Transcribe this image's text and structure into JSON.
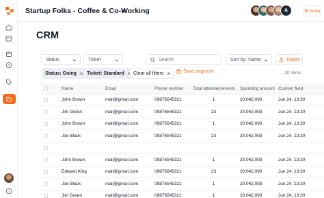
{
  "header": {
    "workspace_title": "Startup Folks - Coffee & Co-Working",
    "avatar_initial": "A",
    "invite_label": "Invite"
  },
  "page": {
    "title": "CRM"
  },
  "filters": {
    "status_label": "Status",
    "ticket_label": "Ticket",
    "search_placeholder": "Search",
    "sort_label": "Sort by: Name",
    "export_label": "Export"
  },
  "active_filters": {
    "chips": [
      "Status: Going",
      "Ticket: Standard"
    ],
    "clear_label": "Clear all filters",
    "save_label": "Save segment",
    "items_count": "20 items"
  },
  "table": {
    "columns": [
      "Name",
      "Email",
      "Phone number",
      "Total attended events",
      "Spending amount",
      "Custom field"
    ],
    "rows": [
      {
        "name": "John Brown",
        "email": "mail@gmail.com",
        "phone": "09876545321",
        "events": "1",
        "spending": "20,042,093",
        "custom": "Jun 24, 13:30"
      },
      {
        "name": "Jim Green",
        "email": "mail@gmail.com",
        "phone": "09876545321",
        "events": "23",
        "spending": "20,042,093",
        "custom": "Jun 24, 13:30"
      },
      {
        "name": "John Brown",
        "email": "mail@gmail.com",
        "phone": "09876545321",
        "events": "1",
        "spending": "20,042,093",
        "custom": "Jun 24, 13:30"
      },
      {
        "name": "Joe Black",
        "email": "mail@gmail.com",
        "phone": "09876545321",
        "events": "23",
        "spending": "20,042,093",
        "custom": "Jun 24, 13:30"
      },
      {
        "name": "",
        "email": "",
        "phone": "",
        "events": "",
        "spending": "",
        "custom": ""
      },
      {
        "name": "John Brown",
        "email": "mail@gmail.com",
        "phone": "09876545321",
        "events": "1",
        "spending": "20,042,093",
        "custom": "Jun 24, 13:30"
      },
      {
        "name": "Edward King",
        "email": "mail@gmail.com",
        "phone": "09876545321",
        "events": "23",
        "spending": "20,042,093",
        "custom": "Jun 24, 13:30"
      },
      {
        "name": "Joe Black",
        "email": "mail@gmail.com",
        "phone": "09876545321",
        "events": "1",
        "spending": "20,042,093",
        "custom": "Jun 24, 13:30"
      },
      {
        "name": "Jim Green",
        "email": "mail@gmail.com",
        "phone": "09876545321",
        "events": "1",
        "spending": "20,042,093",
        "custom": "Jun 24, 13:30"
      }
    ]
  },
  "colors": {
    "accent": "#f26b1d",
    "border": "#eceef1",
    "chip_bg": "#eceef1"
  },
  "icons": {
    "logo": "brand-logo-icon",
    "sidebar": [
      "home-icon",
      "calendar-icon",
      "box-icon",
      "clock-icon",
      "tag-icon",
      "folder-icon",
      "help-icon"
    ],
    "search": "search-icon",
    "export": "export-icon",
    "save": "save-icon"
  }
}
